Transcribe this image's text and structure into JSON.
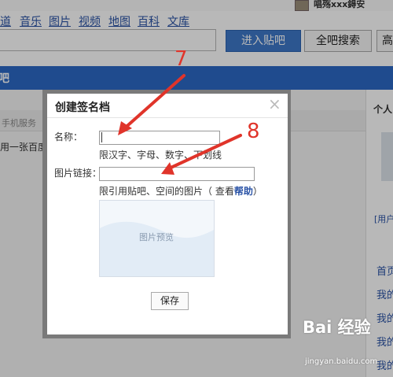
{
  "header": {
    "user_name": "唱殇xxx鍀安",
    "nav_links": [
      "道",
      "音乐",
      "图片",
      "视频",
      "地图",
      "百科",
      "文库"
    ],
    "enter_bar_label": "进入贴吧",
    "all_search_label": "全吧搜索",
    "cut_label": "高"
  },
  "band": {
    "text": "吧"
  },
  "background": {
    "phone_service": "手机服务",
    "use_image_text": "用一张百度则",
    "personal_label": "个人",
    "user_short": "[用户",
    "right_links": [
      "首页",
      "我的",
      "我的",
      "我的",
      "我的"
    ]
  },
  "dialog": {
    "title": "创建签名档",
    "close_icon": "×",
    "name_label": "名称：",
    "name_value": "",
    "name_hint": "限汉字、字母、数字、下划线",
    "image_link_label": "图片链接：",
    "image_link_value": "",
    "image_hint_prefix": "限引用贴吧、空间的图片（ 查看",
    "image_hint_link": "帮助",
    "image_hint_suffix": "）",
    "preview_label": "图片预览",
    "save_label": "保存"
  },
  "annotations": {
    "num_7": "7",
    "num_8": "8",
    "color": "#e0342a"
  },
  "watermark": {
    "logo": "Bai 经验",
    "url": "jingyan.baidu.com"
  }
}
